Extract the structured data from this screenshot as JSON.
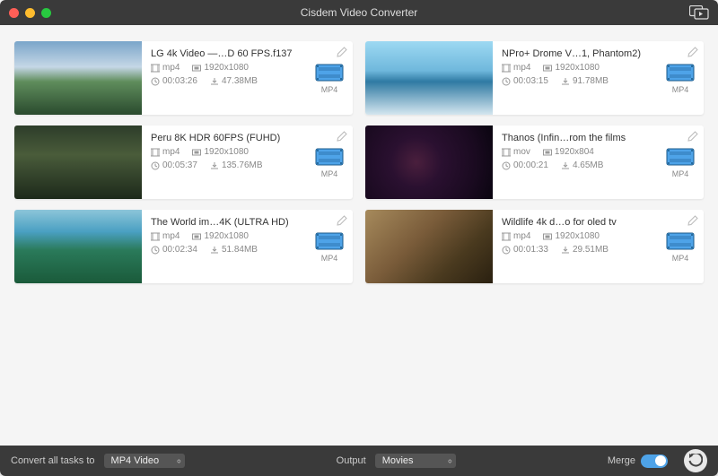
{
  "app_title": "Cisdem Video Converter",
  "videos": [
    {
      "title": "LG 4k Video —…D 60 FPS.f137",
      "format": "mp4",
      "resolution": "1920x1080",
      "duration": "00:03:26",
      "size": "47.38MB",
      "output": "MP4"
    },
    {
      "title": "NPro+ Drome V…1, Phantom2)",
      "format": "mp4",
      "resolution": "1920x1080",
      "duration": "00:03:15",
      "size": "91.78MB",
      "output": "MP4"
    },
    {
      "title": "Peru 8K HDR 60FPS (FUHD)",
      "format": "mp4",
      "resolution": "1920x1080",
      "duration": "00:05:37",
      "size": "135.76MB",
      "output": "MP4"
    },
    {
      "title": "Thanos (Infin…rom the films",
      "format": "mov",
      "resolution": "1920x804",
      "duration": "00:00:21",
      "size": "4.65MB",
      "output": "MP4"
    },
    {
      "title": "The World im…4K (ULTRA HD)",
      "format": "mp4",
      "resolution": "1920x1080",
      "duration": "00:02:34",
      "size": "51.84MB",
      "output": "MP4"
    },
    {
      "title": "Wildlife 4k d…o for oled tv",
      "format": "mp4",
      "resolution": "1920x1080",
      "duration": "00:01:33",
      "size": "29.51MB",
      "output": "MP4"
    }
  ],
  "footer": {
    "convert_label": "Convert all tasks to",
    "convert_value": "MP4 Video",
    "output_label": "Output",
    "output_value": "Movies",
    "merge_label": "Merge"
  }
}
